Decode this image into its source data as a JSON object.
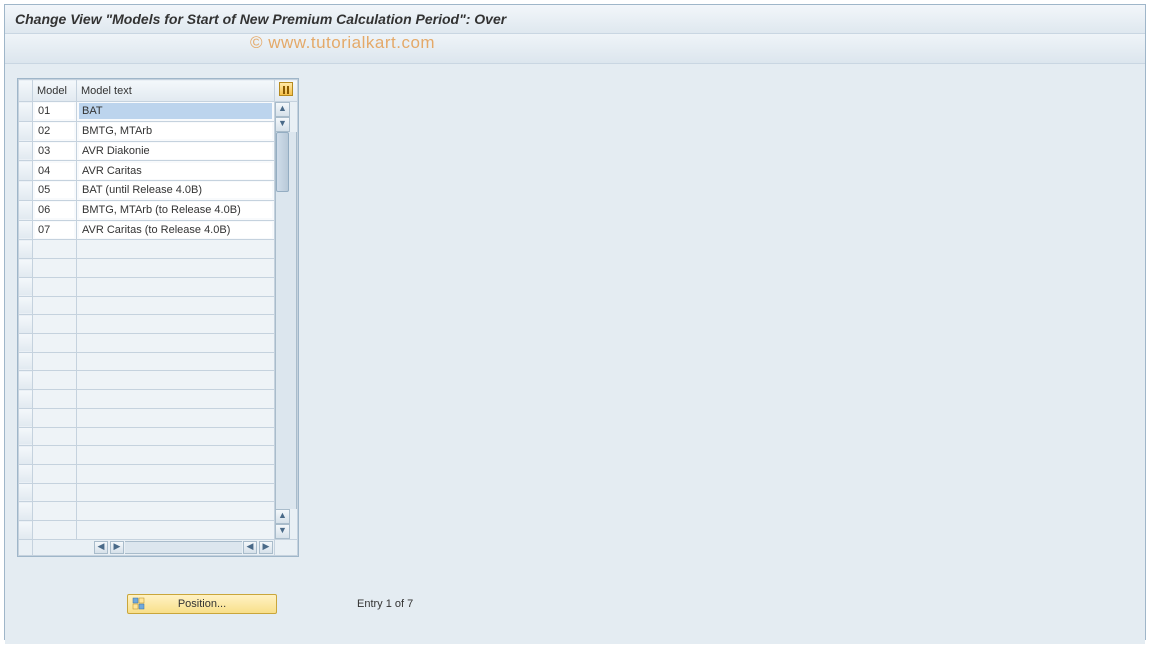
{
  "title": "Change View \"Models for Start of New Premium Calculation Period\": Over",
  "watermark": "© www.tutorialkart.com",
  "columns": {
    "model": "Model",
    "model_text": "Model text"
  },
  "rows": [
    {
      "model": "01",
      "text": "BAT"
    },
    {
      "model": "02",
      "text": "BMTG, MTArb"
    },
    {
      "model": "03",
      "text": "AVR Diakonie"
    },
    {
      "model": "04",
      "text": "AVR Caritas"
    },
    {
      "model": "05",
      "text": "BAT (until Release 4.0B)"
    },
    {
      "model": "06",
      "text": "BMTG, MTArb (to Release 4.0B)"
    },
    {
      "model": "07",
      "text": "AVR Caritas (to Release 4.0B)"
    }
  ],
  "empty_rows": 16,
  "footer": {
    "position_label": "Position...",
    "entry_status": "Entry 1 of 7"
  }
}
